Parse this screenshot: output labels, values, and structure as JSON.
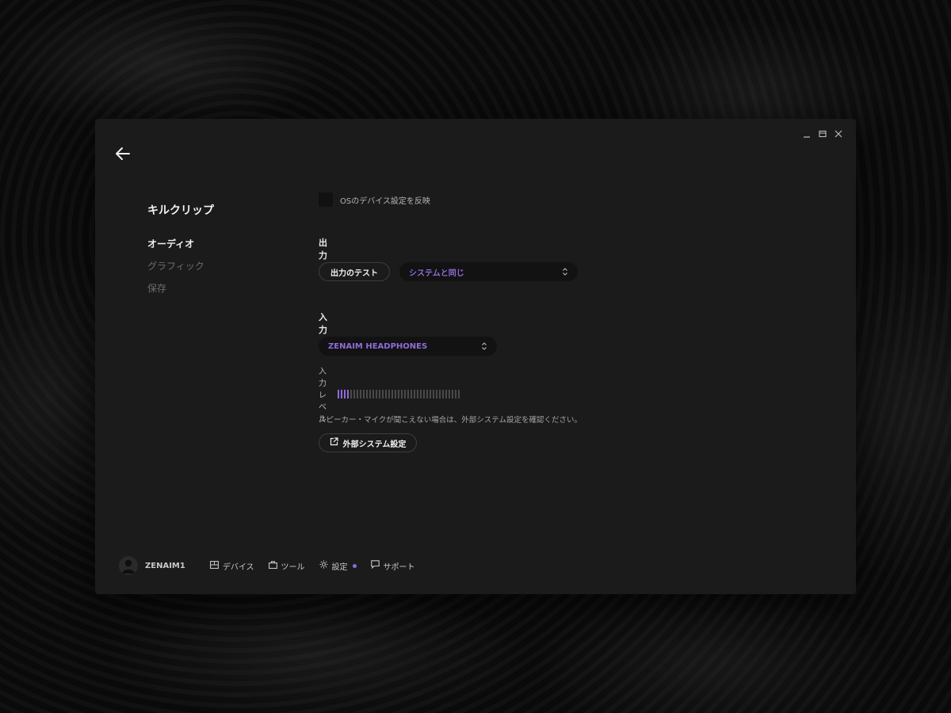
{
  "app": {
    "title": "キルクリップ"
  },
  "window_controls": {
    "minimize_icon": "minimize-icon",
    "maximize_icon": "maximize-icon",
    "close_icon": "close-icon"
  },
  "sidebar": {
    "items": [
      {
        "label": "オーディオ",
        "active": true
      },
      {
        "label": "グラフィック",
        "active": false
      },
      {
        "label": "保存",
        "active": false
      }
    ]
  },
  "settings": {
    "mirror_os_label": "OSのデバイス設定を反映",
    "mirror_os_checked": false,
    "output": {
      "title": "出力",
      "test_button": "出力のテスト",
      "device_value": "システムと同じ"
    },
    "input": {
      "title": "入力",
      "device_value": "ZENAIM HEADPHONES",
      "level_label": "入力レベル",
      "level_active_segments": 4,
      "level_total_segments": 39
    },
    "notice": "スピーカー・マイクが聞こえない場合は、外部システム設定を確認ください。",
    "external_button": "外部システム設定"
  },
  "footer": {
    "username": "ZENAIM1",
    "nav": [
      {
        "label": "デバイス",
        "icon": "device-icon"
      },
      {
        "label": "ツール",
        "icon": "toolbox-icon"
      },
      {
        "label": "設定",
        "icon": "gear-icon",
        "badge": true
      },
      {
        "label": "サポート",
        "icon": "chat-icon"
      }
    ]
  },
  "colors": {
    "accent": "#8e6cd8",
    "panel": "#1b1b1c",
    "text": "#f0f0f0"
  }
}
